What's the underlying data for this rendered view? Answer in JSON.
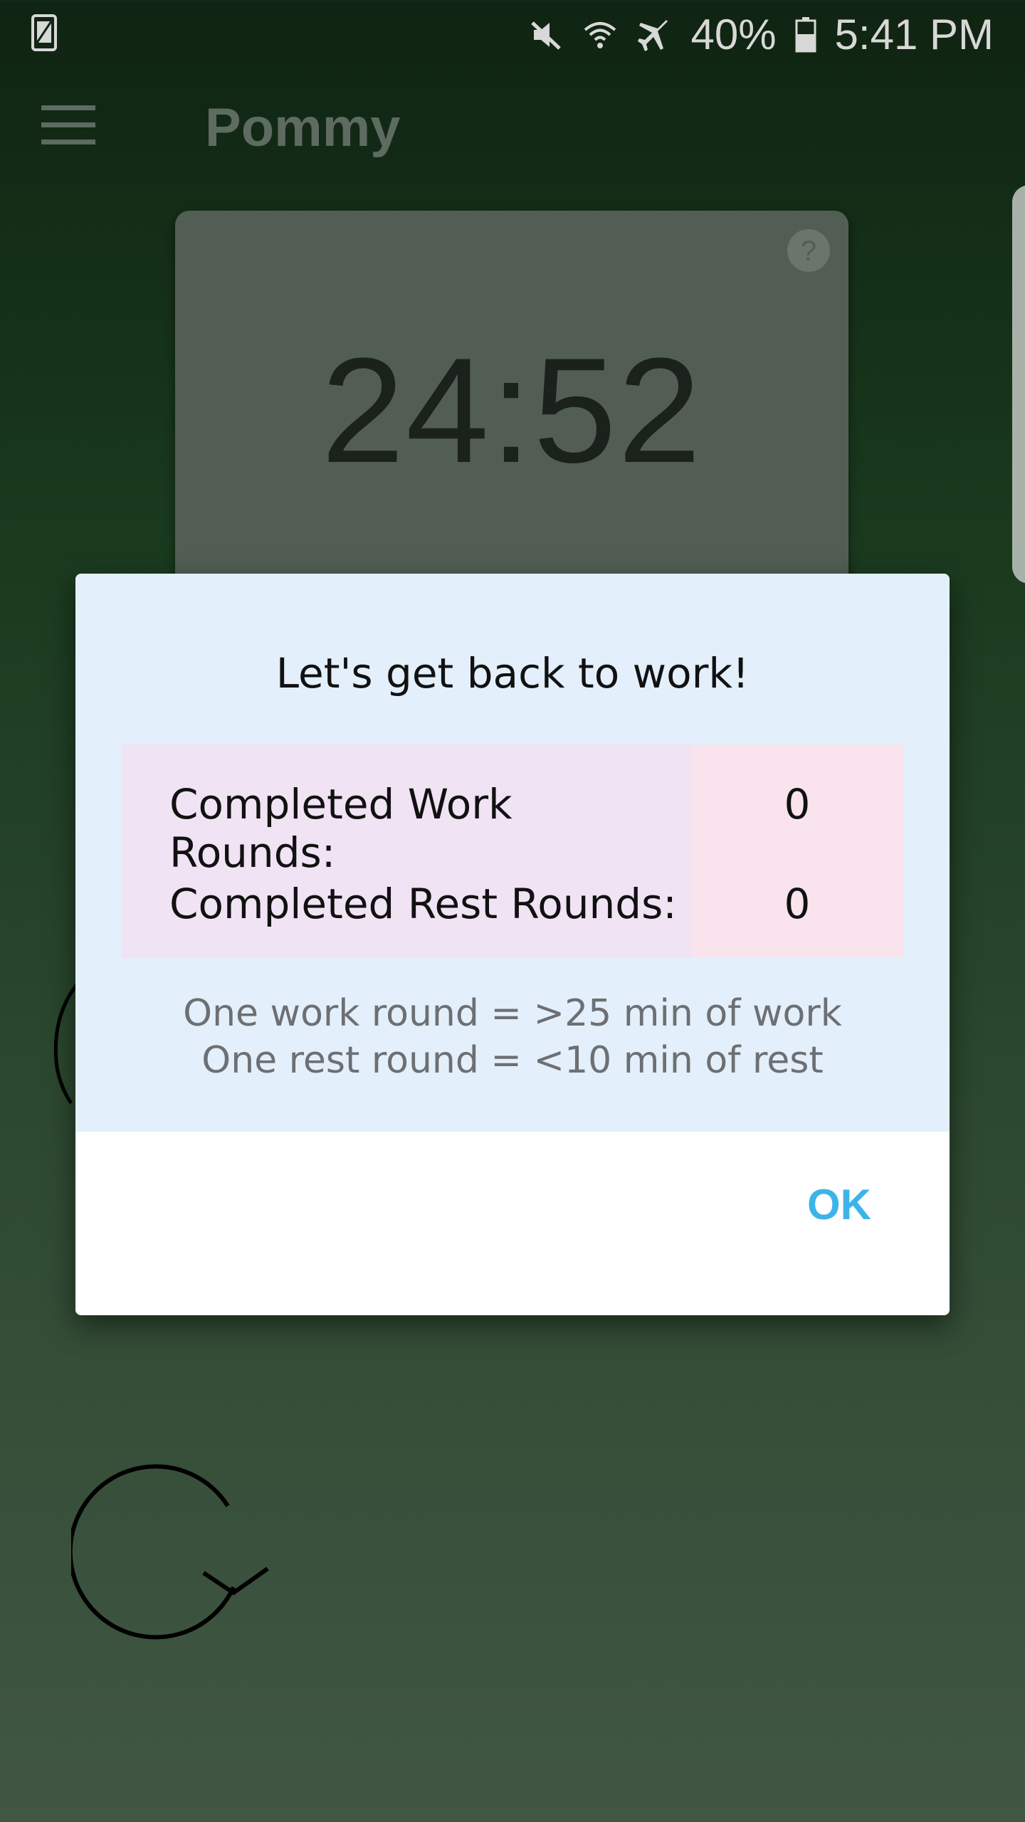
{
  "status_bar": {
    "battery": "40%",
    "time": "5:41 PM",
    "icons": [
      "screenshot-icon",
      "mute-icon",
      "wifi-icon",
      "airplane-icon",
      "battery-icon"
    ]
  },
  "app_bar": {
    "title": "Pommy"
  },
  "timer": {
    "time": "24:52"
  },
  "dialog": {
    "title": "Let's get back to work!",
    "rows": [
      {
        "label": "Completed Work Rounds:",
        "value": "0"
      },
      {
        "label": "Completed Rest Rounds:",
        "value": "0"
      }
    ],
    "notes": [
      "One work round = >25 min of work",
      "One rest round = <10 min of rest"
    ],
    "ok_label": "OK"
  },
  "colors": {
    "accent": "#3cb4e9",
    "dialog_bg": "#e3f0fb"
  }
}
